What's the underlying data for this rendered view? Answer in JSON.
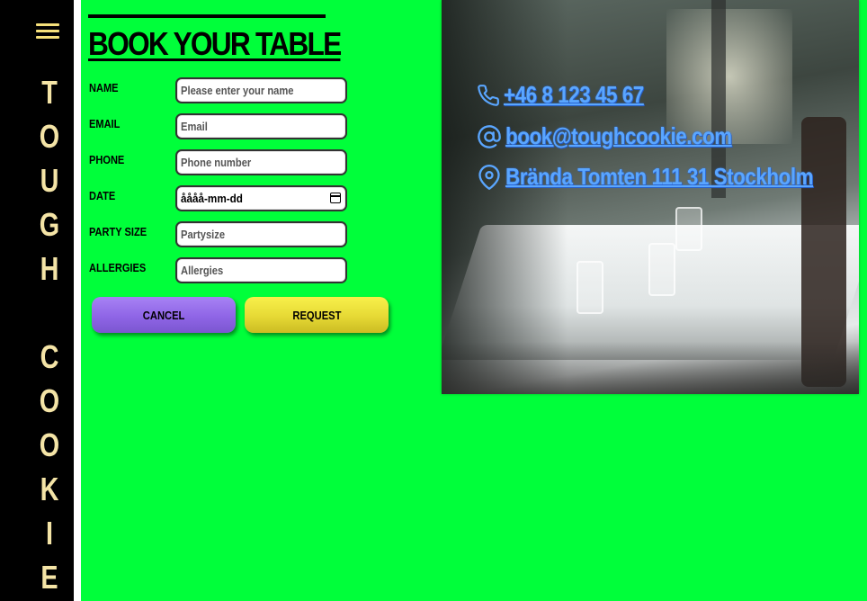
{
  "sidebar": {
    "menu_icon": "hamburger-icon",
    "brand_letters": [
      "T",
      "O",
      "U",
      "G",
      "H",
      " ",
      "C",
      "O",
      "O",
      "K",
      "I",
      "E"
    ]
  },
  "form": {
    "title": "BOOK YOUR TABLE",
    "fields": [
      {
        "label": "NAME",
        "placeholder": "Please enter your name",
        "value": ""
      },
      {
        "label": "EMAIL",
        "placeholder": "Email",
        "value": ""
      },
      {
        "label": "PHONE",
        "placeholder": "Phone number",
        "value": ""
      },
      {
        "label": "DATE",
        "placeholder": "",
        "value": "åååå-mm-dd"
      },
      {
        "label": "PARTY SIZE",
        "placeholder": "Partysize",
        "value": ""
      },
      {
        "label": "ALLERGIES",
        "placeholder": "Allergies",
        "value": ""
      }
    ],
    "cancel_label": "CANCEL",
    "request_label": "REQUEST"
  },
  "contact": {
    "phone": "+46 8 123 45 67",
    "email": "book@toughcookie.com",
    "address": "Brända Tomten 111 31 Stockholm",
    "phone_icon": "phone-icon",
    "email_icon": "at-sign-icon",
    "address_icon": "map-pin-icon",
    "link_color": "#5aa6ff"
  },
  "colors": {
    "background": "#00ff3a",
    "sidebar": "#000000",
    "brand_text": "#f4e4a6",
    "cancel_button": "#9a70ec",
    "request_button": "#ebe03a"
  }
}
